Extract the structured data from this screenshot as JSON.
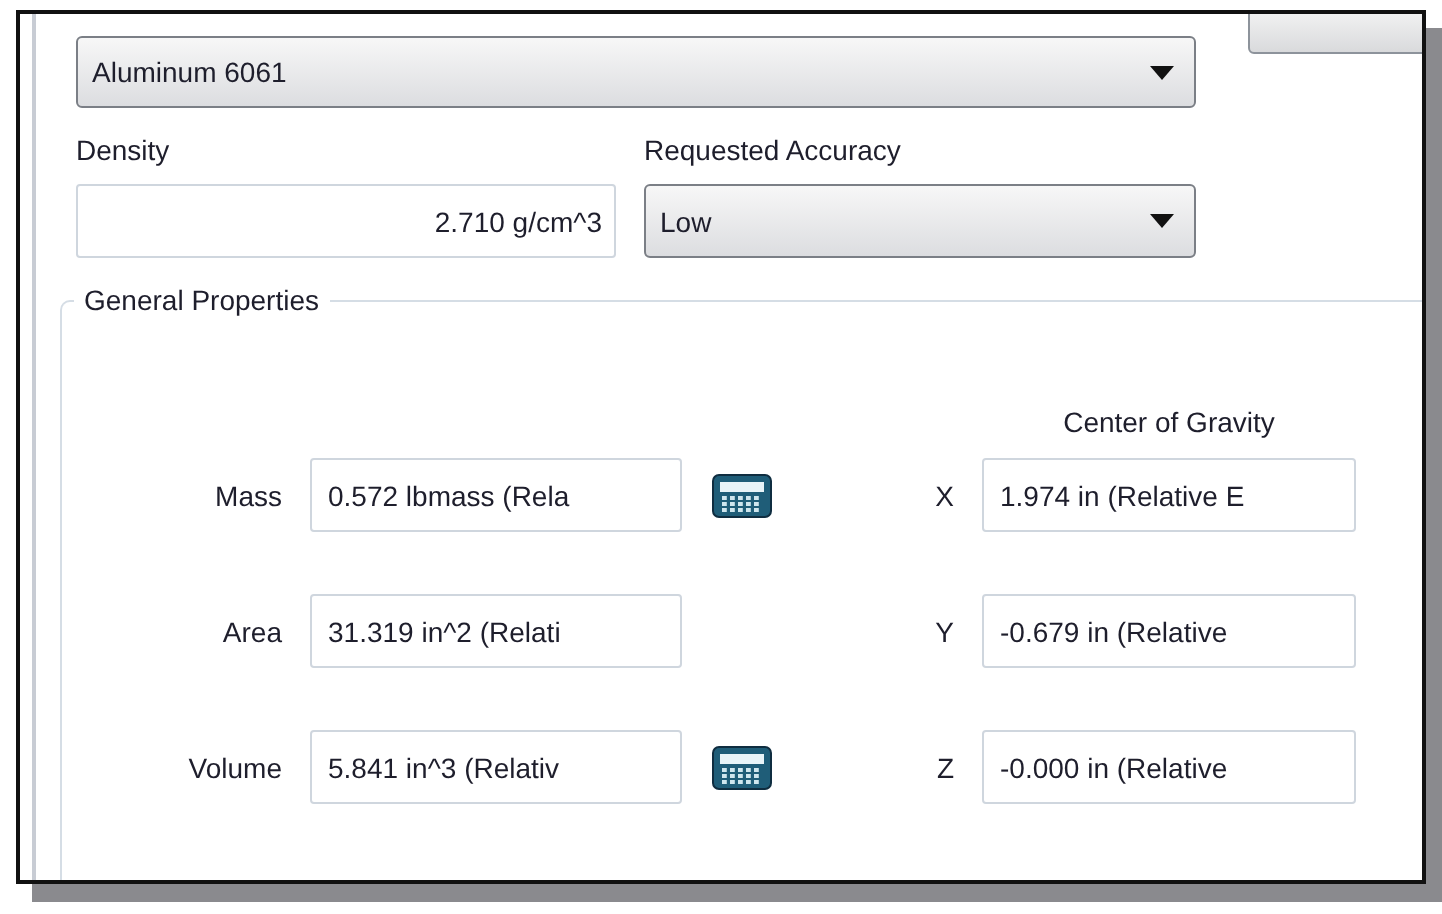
{
  "material": {
    "value": "Aluminum 6061"
  },
  "density": {
    "label": "Density",
    "value": "2.710 g/cm^3"
  },
  "accuracy": {
    "label": "Requested Accuracy",
    "value": "Low"
  },
  "general_properties": {
    "title": "General Properties",
    "center_of_gravity_label": "Center of Gravity",
    "rows": [
      {
        "label": "Mass",
        "value": "0.572 lbmass (Rela",
        "calculator": true,
        "axis": "X",
        "axis_value": "1.974 in (Relative E"
      },
      {
        "label": "Area",
        "value": "31.319 in^2 (Relati",
        "calculator": false,
        "axis": "Y",
        "axis_value": "-0.679 in (Relative"
      },
      {
        "label": "Volume",
        "value": "5.841 in^3 (Relativ",
        "calculator": true,
        "axis": "Z",
        "axis_value": "-0.000 in (Relative"
      }
    ]
  }
}
